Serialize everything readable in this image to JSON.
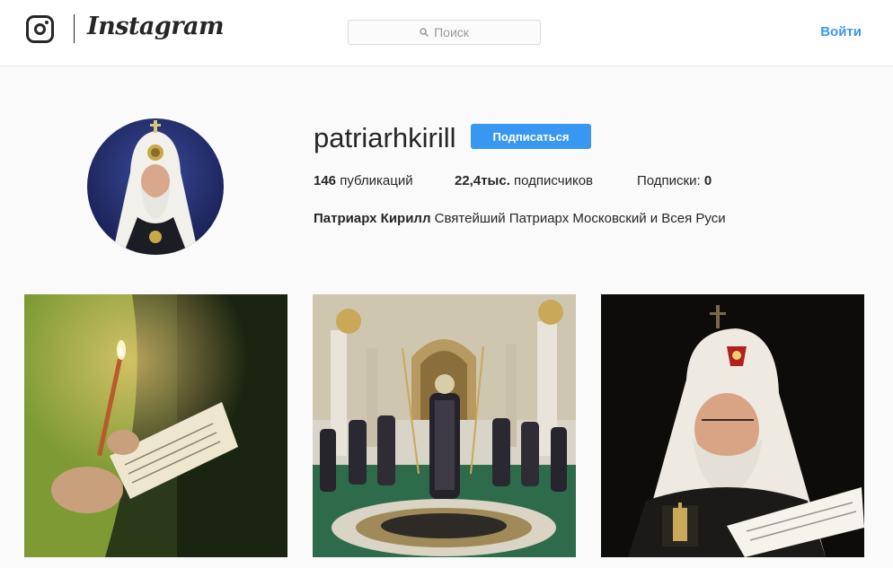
{
  "header": {
    "brand_name": "Instagram",
    "search_placeholder": "Поиск",
    "login_label": "Войти",
    "accent_color": "#3897f0"
  },
  "profile": {
    "username": "patriarhkirill",
    "follow_label": "Подписаться",
    "stats": {
      "posts_value": "146",
      "posts_label": "публикаций",
      "followers_value": "22,4тыс.",
      "followers_label": "подписчиков",
      "following_label": "Подписки:",
      "following_value": "0"
    },
    "bio_name": "Патриарх Кирилл",
    "bio_text": "Святейший Патриарх Московский и Всея Руси"
  },
  "posts": [
    {
      "icon": "candle-prayer-photo"
    },
    {
      "icon": "cathedral-service-photo"
    },
    {
      "icon": "patriarch-reading-photo"
    }
  ]
}
